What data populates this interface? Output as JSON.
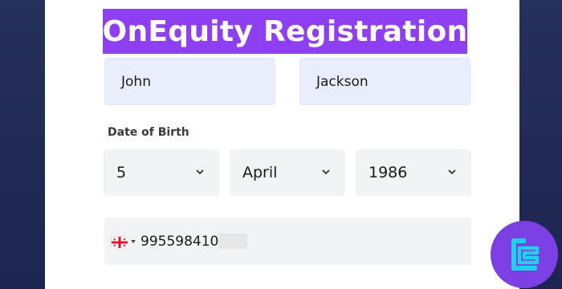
{
  "title": "OnEquity Registration",
  "form": {
    "first_name": "John",
    "last_name": "Jackson",
    "dob_label": "Date of Birth",
    "day": "5",
    "month": "April",
    "year": "1986",
    "phone_number": "995598410"
  },
  "icons": {
    "flag": "georgia-flag-icon",
    "dropdown": "chevron-down-icon",
    "logo": "brand-logo-icon"
  },
  "colors": {
    "banner": "#8f3ff2",
    "input_bg": "#e8eefc",
    "select_bg": "#f2f3f5",
    "page_bg": "#1f2a52",
    "logo_bg": "#7b3fe4"
  }
}
